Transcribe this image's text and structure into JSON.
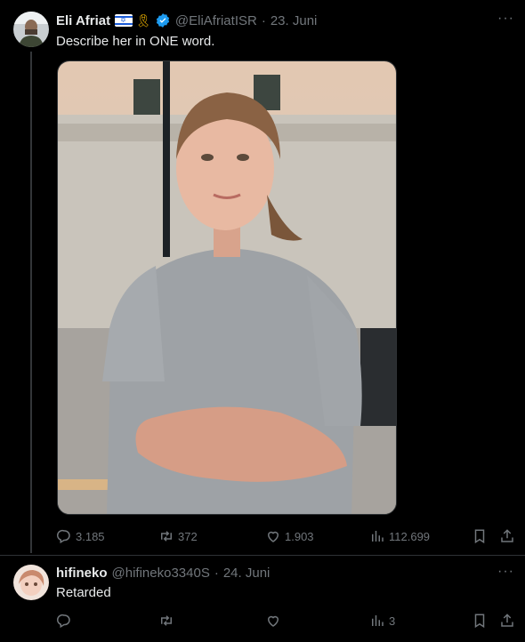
{
  "tweet": {
    "author_name": "Eli Afriat",
    "flag_icon": "israel-flag-icon",
    "ribbon": "🎗",
    "handle": "@EliAfriatISR",
    "separator": "·",
    "date": "23. Juni",
    "text": "Describe her in ONE word.",
    "more": "···",
    "media_description": "photo",
    "actions": {
      "replies": "3.185",
      "retweets": "372",
      "likes": "1.903",
      "views": "112.699"
    }
  },
  "reply": {
    "author_name": "hifineko",
    "handle": "@hifineko3340S",
    "separator": "·",
    "date": "24. Juni",
    "text": "Retarded",
    "more": "···",
    "actions": {
      "replies": "",
      "retweets": "",
      "likes": "",
      "views": "3"
    }
  },
  "colors": {
    "background": "#000000",
    "text": "#e7e9ea",
    "muted": "#71767b",
    "verified": "#1d9bf0"
  }
}
